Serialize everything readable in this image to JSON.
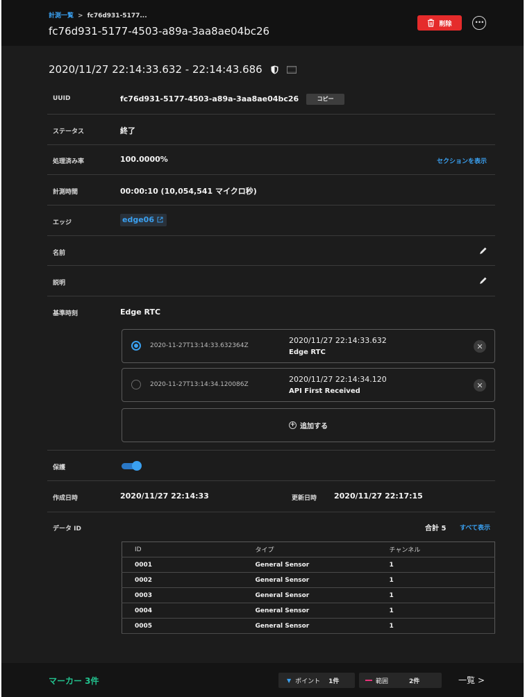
{
  "header": {
    "breadcrumb_root": "計測一覧",
    "breadcrumb_sep": ">",
    "breadcrumb_current": "fc76d931-5177...",
    "title": "fc76d931-5177-4503-a89a-3aa8ae04bc26",
    "delete_label": "削除",
    "more_icon": "more-icon"
  },
  "range": {
    "text": "2020/11/27 22:14:33.632 - 22:14:43.686"
  },
  "uuid": {
    "label": "UUID",
    "value": "fc76d931-5177-4503-a89a-3aa8ae04bc26",
    "copy_label": "コピー"
  },
  "status": {
    "label": "ステータス",
    "value": "終了"
  },
  "processed": {
    "label": "処理済み率",
    "value": "100.0000%",
    "link": "セクションを表示"
  },
  "duration": {
    "label": "計測時間",
    "value": "00:00:10 (10,054,541 マイクロ秒)"
  },
  "edge": {
    "label": "エッジ",
    "value": "edge06"
  },
  "name": {
    "label": "名前"
  },
  "description": {
    "label": "説明"
  },
  "base_time": {
    "label": "基準時刻",
    "value": "Edge RTC",
    "options": [
      {
        "iso": "2020-11-27T13:14:33.632364Z",
        "date": "2020/11/27 22:14:33.632",
        "source": "Edge RTC",
        "selected": true
      },
      {
        "iso": "2020-11-27T13:14:34.120086Z",
        "date": "2020/11/27 22:14:34.120",
        "source": "API First Received",
        "selected": false
      }
    ],
    "add_label": "追加する"
  },
  "protect": {
    "label": "保護",
    "enabled": true
  },
  "created": {
    "label": "作成日時",
    "value": "2020/11/27 22:14:33",
    "updated_label": "更新日時",
    "updated_value": "2020/11/27 22:17:15"
  },
  "data_ids": {
    "label": "データ ID",
    "total_label": "合計",
    "total": "5",
    "show_all": "すべて表示",
    "columns": [
      "ID",
      "タイプ",
      "チャンネル"
    ],
    "rows": [
      [
        "0001",
        "General Sensor",
        "1"
      ],
      [
        "0002",
        "General Sensor",
        "1"
      ],
      [
        "0003",
        "General Sensor",
        "1"
      ],
      [
        "0004",
        "General Sensor",
        "1"
      ],
      [
        "0005",
        "General Sensor",
        "1"
      ]
    ]
  },
  "footer": {
    "markers": "マーカー 3件",
    "point_label": "ポイント",
    "point_count": "1件",
    "range_label": "範囲",
    "range_count": "2件",
    "list_label": "一覧 >"
  },
  "colors": {
    "accent": "#3aa0f0",
    "danger": "#e52b2b",
    "marker": "#22c28e",
    "range_marker": "#e8327a"
  }
}
